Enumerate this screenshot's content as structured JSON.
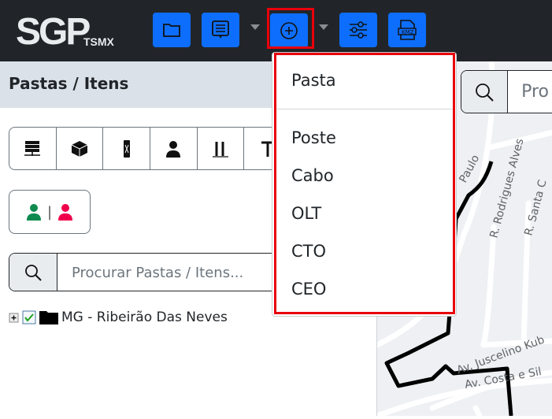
{
  "header": {
    "logo_text": "SGP",
    "logo_sub": "TSMX",
    "buttons": [
      {
        "icon": "folder-icon"
      },
      {
        "icon": "message-icon"
      },
      {
        "icon": "plus-circle-icon"
      },
      {
        "icon": "sliders-icon"
      },
      {
        "icon": "kmz-file-icon",
        "label": "KMZ"
      }
    ],
    "accent": "#0d6efd",
    "highlight": "#e8000b"
  },
  "panel": {
    "title": "Pastas / Itens",
    "type_icons": [
      "server-icon",
      "box-icon",
      "splice-icon",
      "user-icon",
      "fiber-connectors-icon",
      "pole-icon"
    ],
    "users_toggle": {
      "left_color": "#0f8a4f",
      "right_color": "#f0004c",
      "separator": "|"
    },
    "search_placeholder": "Procurar Pastas / Itens...",
    "tree": [
      {
        "label": "MG - Ribeirão Das Neves",
        "checked": true,
        "expanded": false
      }
    ]
  },
  "map": {
    "search_placeholder": "Pro",
    "streets": [
      "Paulo",
      "R. Rodrigues Alves",
      "R. Santa C",
      "Av. Juscelino Kub",
      "Av. Costa e Sil",
      "R."
    ]
  },
  "dropdown": {
    "items": [
      "Pasta",
      "Poste",
      "Cabo",
      "OLT",
      "CTO",
      "CEO"
    ]
  }
}
